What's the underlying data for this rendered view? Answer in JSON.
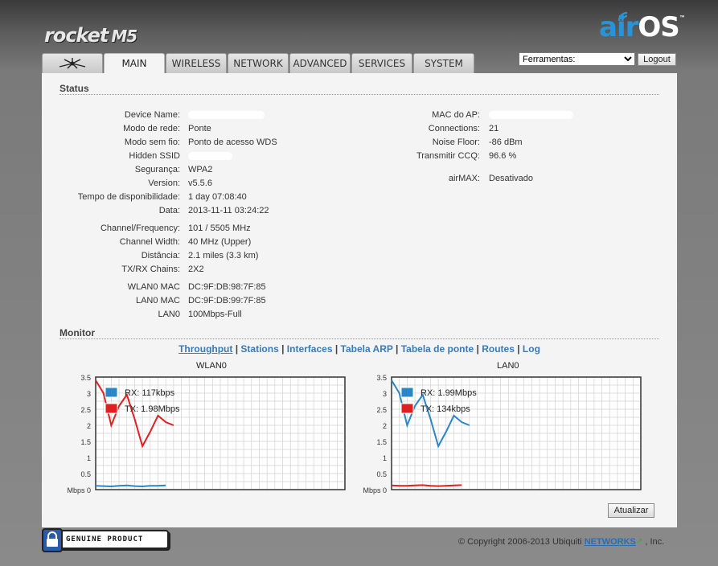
{
  "header": {
    "brand_name": "rocket",
    "brand_model": "M5",
    "os_logo_air": "air",
    "os_logo_os": "OS",
    "os_logo_tm": "™"
  },
  "tabs": [
    {
      "label": "",
      "icon": "ubiquiti-logo-icon"
    },
    {
      "label": "MAIN",
      "active": true
    },
    {
      "label": "WIRELESS"
    },
    {
      "label": "NETWORK"
    },
    {
      "label": "ADVANCED"
    },
    {
      "label": "SERVICES"
    },
    {
      "label": "SYSTEM"
    }
  ],
  "tools": {
    "selected": "Ferramentas:",
    "logout_label": "Logout"
  },
  "status": {
    "title": "Status",
    "left": [
      {
        "label": "Device Name:",
        "value": ""
      },
      {
        "label": "Modo de rede:",
        "value": "Ponte"
      },
      {
        "label": "Modo sem fio:",
        "value": "Ponto de acesso WDS"
      },
      {
        "label": "Hidden SSID",
        "value": ""
      },
      {
        "label": "Segurança:",
        "value": "WPA2"
      },
      {
        "label": "Version:",
        "value": "v5.5.6"
      },
      {
        "label": "Tempo de disponibilidade:",
        "value": "1 day 07:08:40"
      },
      {
        "label": "Data:",
        "value": "2013-11-11 03:24:22"
      },
      {
        "label": "Channel/Frequency:",
        "value": "101 / 5505 MHz"
      },
      {
        "label": "Channel Width:",
        "value": "40 MHz (Upper)"
      },
      {
        "label": "Distância:",
        "value": "2.1 miles (3.3 km)"
      },
      {
        "label": "TX/RX Chains:",
        "value": "2X2"
      },
      {
        "label": "WLAN0 MAC",
        "value": "DC:9F:DB:98:7F:85"
      },
      {
        "label": "LAN0 MAC",
        "value": "DC:9F:DB:99:7F:85"
      },
      {
        "label": "LAN0",
        "value": "100Mbps-Full"
      }
    ],
    "right": [
      {
        "label": "MAC do AP:",
        "value": ""
      },
      {
        "label": "Connections:",
        "value": "21"
      },
      {
        "label": "Noise Floor:",
        "value": "-86 dBm"
      },
      {
        "label": "Transmitir CCQ:",
        "value": "96.6 %"
      },
      {
        "label": "airMAX:",
        "value": "Desativado"
      }
    ]
  },
  "monitor": {
    "title": "Monitor",
    "links": [
      "Throughput",
      "Stations",
      "Interfaces",
      "Tabela ARP",
      "Tabela de ponte",
      "Routes",
      "Log"
    ],
    "selected_link": "Throughput",
    "refresh_label": "Atualizar"
  },
  "chart_data": [
    {
      "type": "line",
      "title": "WLAN0",
      "ylabel": "Mbps",
      "ylim": [
        0,
        3.5
      ],
      "yticks": [
        "0",
        "0.5",
        "1",
        "1.5",
        "2",
        "2.5",
        "3",
        "3.5"
      ],
      "grid": true,
      "legend_position": "top-left",
      "x": [
        0,
        1,
        2,
        3,
        4,
        5,
        6,
        7,
        8,
        9,
        10,
        11,
        12,
        13,
        14,
        15,
        16,
        17,
        18,
        19,
        20,
        21,
        22,
        23,
        24,
        25,
        26,
        27,
        28,
        29,
        30,
        31
      ],
      "series": [
        {
          "name": "RX: 117kbps",
          "color": "#2a86c6",
          "values": [
            0.12,
            0.11,
            0.1,
            0.12,
            0.13,
            0.11,
            0.1,
            0.12,
            0.12,
            0.13
          ]
        },
        {
          "name": "TX: 1.98Mbps",
          "color": "#e02020",
          "values": [
            3.4,
            3.0,
            2.0,
            2.6,
            2.95,
            2.2,
            1.35,
            1.8,
            2.3,
            2.1,
            2.0
          ]
        }
      ]
    },
    {
      "type": "line",
      "title": "LAN0",
      "ylabel": "Mbps",
      "ylim": [
        0,
        3.5
      ],
      "yticks": [
        "0",
        "0.5",
        "1",
        "1.5",
        "2",
        "2.5",
        "3",
        "3.5"
      ],
      "grid": true,
      "legend_position": "top-left",
      "x": [
        0,
        1,
        2,
        3,
        4,
        5,
        6,
        7,
        8,
        9,
        10,
        11,
        12,
        13,
        14,
        15,
        16,
        17,
        18,
        19,
        20,
        21,
        22,
        23,
        24,
        25,
        26,
        27,
        28,
        29,
        30,
        31
      ],
      "series": [
        {
          "name": "RX: 1.99Mbps",
          "color": "#2a86c6",
          "values": [
            3.4,
            3.0,
            2.0,
            2.6,
            2.95,
            2.2,
            1.35,
            1.8,
            2.3,
            2.1,
            2.0
          ]
        },
        {
          "name": "TX: 134kbps",
          "color": "#e02020",
          "values": [
            0.13,
            0.12,
            0.12,
            0.13,
            0.14,
            0.12,
            0.11,
            0.12,
            0.13,
            0.14
          ]
        }
      ]
    }
  ],
  "footer": {
    "genuine_text": "GENUINE   PRODUCT",
    "copyright_prefix": "© Copyright 2006-2013 Ubiquiti",
    "networks_link": "NETWORKS",
    "copyright_suffix": ", Inc."
  }
}
